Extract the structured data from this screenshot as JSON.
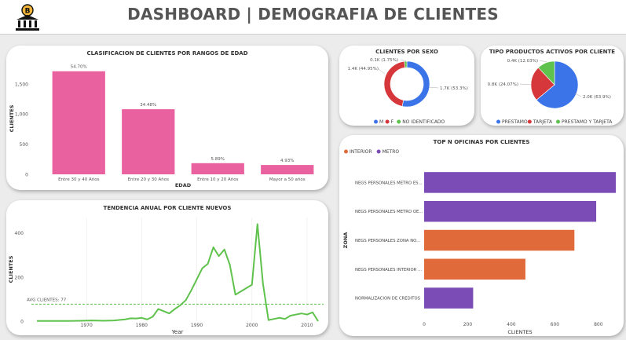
{
  "header": {
    "title": "DASHBOARD | DEMOGRAFIA DE CLIENTES",
    "logo_icon": "bitcoin-bank-icon"
  },
  "colors": {
    "pink": "#e9619f",
    "green": "#5fc24d",
    "purple": "#7b4bb6",
    "orange": "#e06a3a",
    "blue": "#3a74e8",
    "red": "#d6373b",
    "gray_text": "#555555"
  },
  "age_chart": {
    "title": "CLASIFICACION DE CLIENTES POR RANGOS DE EDAD",
    "xlabel": "EDAD",
    "ylabel": "CLIENTES"
  },
  "sex_chart": {
    "title": "CLIENTES POR SEXO"
  },
  "product_chart": {
    "title": "TIPO PRODUCTOS ACTIVOS POR CLIENTE"
  },
  "trend_chart": {
    "title": "TENDENCIA ANUAL POR CLIENTE NUEVOS",
    "xlabel": "Year",
    "ylabel": "CLIENTES",
    "avg_label": "AVG CLIENTES: 77"
  },
  "offices_chart": {
    "title": "TOP N OFICINAS POR CLIENTES",
    "xlabel": "CLIENTES",
    "ylabel": "ZONA"
  },
  "chart_data": [
    {
      "id": "age",
      "type": "bar",
      "categories": [
        "Entre 30 y 40 Años",
        "Entre 20 y 30 Años",
        "Entre 10 y 20 Años",
        "Mayor a 50 años"
      ],
      "values": [
        1710,
        1080,
        185,
        155
      ],
      "data_labels": [
        "54.70%",
        "34.48%",
        "5.89%",
        "4.93%"
      ],
      "yticks": [
        0,
        500,
        1000,
        1500
      ],
      "ytick_labels": [
        "0",
        "500",
        "1,000",
        "1,500"
      ],
      "ylim": [
        0,
        1850
      ],
      "xlabel": "EDAD",
      "ylabel": "CLIENTES",
      "grid": false
    },
    {
      "id": "sex",
      "type": "pie",
      "donut": true,
      "labels": [
        "M",
        "F",
        "NO IDENTIFICADO"
      ],
      "values": [
        53.3,
        44.95,
        1.75
      ],
      "data_labels": [
        "1.7K (53.3%)",
        "1.4K (44.95%)",
        "0.1K (1.75%)"
      ],
      "colors": [
        "#3a74e8",
        "#d6373b",
        "#5fc24d"
      ],
      "legend": "bottom"
    },
    {
      "id": "products",
      "type": "pie",
      "donut": false,
      "labels": [
        "PRESTAMO",
        "TARJETA",
        "PRESTAMO Y TARJETA"
      ],
      "values": [
        63.9,
        24.07,
        12.03
      ],
      "data_labels": [
        "2.0K (63.9%)",
        "0.8K (24.07%)",
        "0.4K (12.03%)"
      ],
      "colors": [
        "#3a74e8",
        "#d6373b",
        "#5fc24d"
      ],
      "legend": "bottom"
    },
    {
      "id": "trend",
      "type": "line",
      "x": [
        1961,
        1963,
        1965,
        1967,
        1969,
        1971,
        1973,
        1975,
        1977,
        1978,
        1979,
        1980,
        1981,
        1982,
        1983,
        1984,
        1985,
        1986,
        1987,
        1988,
        1989,
        1990,
        1991,
        1992,
        1993,
        1994,
        1995,
        1996,
        1997,
        1998,
        1999,
        2000,
        2001,
        2002,
        2003,
        2004,
        2005,
        2006,
        2007,
        2008,
        2009,
        2010,
        2011,
        2012
      ],
      "series": [
        {
          "name": "",
          "values": [
            1,
            1,
            1,
            1,
            2,
            3,
            2,
            3,
            8,
            13,
            12,
            15,
            8,
            20,
            55,
            45,
            35,
            55,
            72,
            95,
            140,
            190,
            240,
            260,
            335,
            295,
            325,
            255,
            120,
            135,
            150,
            165,
            440,
            170,
            5,
            10,
            15,
            10,
            25,
            30,
            35,
            30,
            40,
            0
          ]
        }
      ],
      "avg_value": 77,
      "yticks": [
        0,
        200,
        400
      ],
      "xticks": [
        1970,
        1980,
        1990,
        2000,
        2010
      ],
      "xlim": [
        1960,
        2013
      ],
      "ylim": [
        0,
        470
      ],
      "xlabel": "Year",
      "ylabel": "CLIENTES",
      "grid": true
    },
    {
      "id": "offices",
      "type": "bar",
      "orientation": "horizontal",
      "categories": [
        "NEGS PERSONALES METRO ES...",
        "NEGS PERSONALES METRO OE...",
        "NEGS PERSONALES ZONA NO...",
        "NEGS PERSONALES INTERIOR ...",
        "NORMALIZACION DE CREDITOS"
      ],
      "values": [
        880,
        790,
        690,
        465,
        225
      ],
      "groups": [
        "METRO",
        "METRO",
        "INTERIOR",
        "INTERIOR",
        "METRO"
      ],
      "legend_entries": [
        "INTERIOR",
        "METRO"
      ],
      "legend_colors": [
        "#e06a3a",
        "#7b4bb6"
      ],
      "xticks": [
        0,
        200,
        400,
        600,
        800
      ],
      "xlim": [
        0,
        880
      ],
      "xlabel": "CLIENTES",
      "ylabel": "ZONA",
      "legend": "top-left"
    }
  ]
}
